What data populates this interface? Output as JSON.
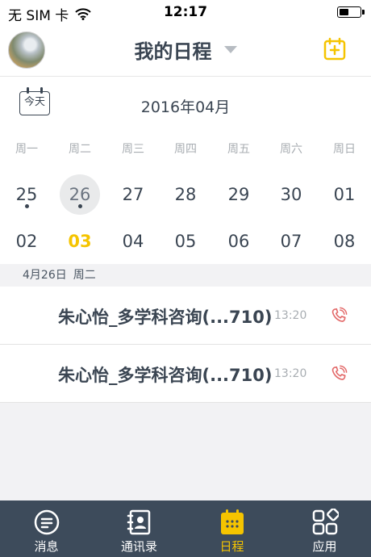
{
  "status_bar": {
    "carrier": "无 SIM 卡",
    "time": "12:17"
  },
  "header": {
    "title": "我的日程",
    "avatar_icon": "user-avatar",
    "add_icon": "calendar-plus-icon",
    "accent_color": "#f5c400"
  },
  "calendar": {
    "today_label": "今天",
    "month_label": "2016年04月",
    "weekdays": [
      "周一",
      "周二",
      "周三",
      "周四",
      "周五",
      "周六",
      "周日"
    ],
    "week1": [
      "25",
      "26",
      "27",
      "28",
      "29",
      "30",
      "01"
    ],
    "week2": [
      "02",
      "03",
      "04",
      "05",
      "06",
      "07",
      "08"
    ],
    "selected_day": "26",
    "today_day": "03",
    "event_days": [
      "25",
      "26"
    ]
  },
  "section": {
    "date": "4月26日",
    "weekday": "周二"
  },
  "events": [
    {
      "title": "朱心怡_多学科咨询(...710)",
      "time": "13:20",
      "icon": "phone-icon"
    },
    {
      "title": "朱心怡_多学科咨询(...710)",
      "time": "13:20",
      "icon": "phone-icon"
    }
  ],
  "tabs": [
    {
      "label": "消息",
      "icon": "message-icon"
    },
    {
      "label": "通讯录",
      "icon": "contacts-icon"
    },
    {
      "label": "日程",
      "icon": "calendar-icon",
      "active": true
    },
    {
      "label": "应用",
      "icon": "apps-icon"
    }
  ]
}
